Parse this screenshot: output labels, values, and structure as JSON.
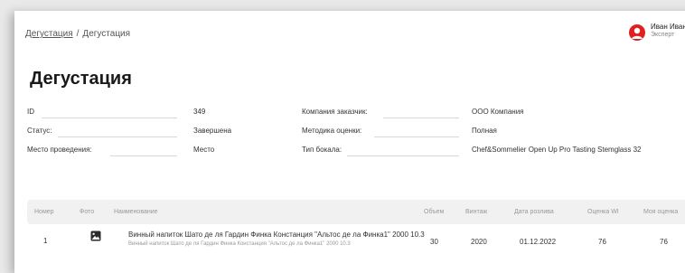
{
  "breadcrumb": {
    "link": "Дегустация",
    "separator": "/",
    "current": "Дегустация"
  },
  "user": {
    "name": "Иван Иванов",
    "role": "Эксперт",
    "avatar_color": "#e02020"
  },
  "page_title": "Дегустация",
  "fields": {
    "id": {
      "label": "ID",
      "value": "349"
    },
    "status": {
      "label": "Статус:",
      "value": "Завершена"
    },
    "venue": {
      "label": "Место проведения:",
      "value": "Место"
    },
    "company": {
      "label": "Компания заказчик:",
      "value": "ООО Компания"
    },
    "method": {
      "label": "Методика оценки:",
      "value": "Полная"
    },
    "glass": {
      "label": "Тип бокала:",
      "value": "Chef&Sommelier Open Up Pro Tasting Stemglass 32"
    }
  },
  "table": {
    "headers": {
      "number": "Номер",
      "photo": "Фото",
      "name": "Наименование",
      "volume": "Объем",
      "vintage": "Винтаж",
      "bottling_date": "Дата розлива",
      "wi_score": "Оценка WI",
      "my_score": "Моя оценка"
    },
    "rows": [
      {
        "number": "1",
        "photo_icon": "image-icon",
        "name": "Винный напиток Шато де ля Гардин Финка Констанция \"Альтос де ла Финка1\" 2000 10.3",
        "name_sub": "Винный напиток Шато де ля Гардин Финка Констанция \"Альтос де ла Финка1\" 2000 10.3",
        "volume": "30",
        "vintage": "2020",
        "bottling_date": "01.12.2022",
        "wi_score": "76",
        "my_score": "76"
      }
    ]
  }
}
